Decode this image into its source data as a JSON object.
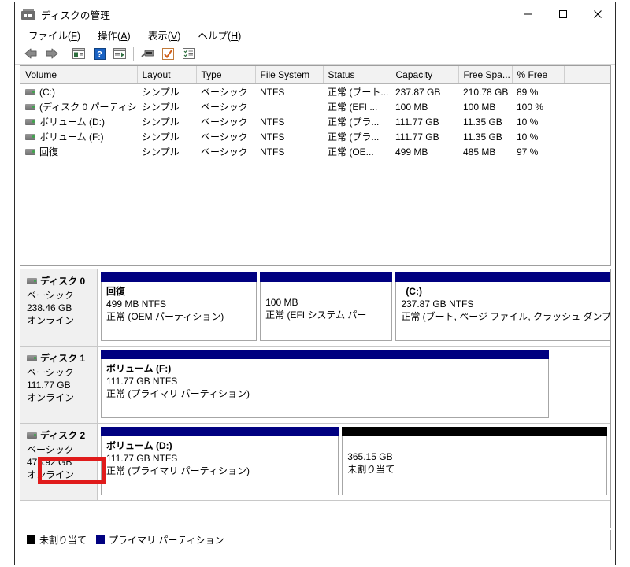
{
  "window": {
    "title": "ディスクの管理",
    "icon": "disk-management-icon",
    "controls": {
      "minimize": "–",
      "maximize": "□",
      "close": "✕"
    }
  },
  "menubar": {
    "items": [
      {
        "name": "file",
        "text": "ファイル",
        "accel": "F"
      },
      {
        "name": "action",
        "text": "操作",
        "accel": "A"
      },
      {
        "name": "view",
        "text": "表示",
        "accel": "V"
      },
      {
        "name": "help",
        "text": "ヘルプ",
        "accel": "H"
      }
    ]
  },
  "toolbar": {
    "buttons": [
      "back-arrow-icon",
      "forward-arrow-icon",
      "separator",
      "show-console-tree-icon",
      "help-icon",
      "show-action-pane-icon",
      "separator",
      "rescan-disks-icon",
      "properties-icon",
      "list-view-icon"
    ]
  },
  "volume_list": {
    "columns": [
      "Volume",
      "Layout",
      "Type",
      "File System",
      "Status",
      "Capacity",
      "Free Spa...",
      "% Free",
      ""
    ],
    "rows": [
      {
        "volume": "(C:)",
        "layout": "シンプル",
        "type": "ベーシック",
        "filesystem": "NTFS",
        "status": "正常 (ブート...",
        "capacity": "237.87 GB",
        "free_space": "210.78 GB",
        "percent_free": "89 %"
      },
      {
        "volume": "(ディスク 0 パーティシ...",
        "layout": "シンプル",
        "type": "ベーシック",
        "filesystem": "",
        "status": "正常 (EFI ...",
        "capacity": "100 MB",
        "free_space": "100 MB",
        "percent_free": "100 %"
      },
      {
        "volume": "ボリューム (D:)",
        "layout": "シンプル",
        "type": "ベーシック",
        "filesystem": "NTFS",
        "status": "正常 (プラ...",
        "capacity": "111.77 GB",
        "free_space": "11.35 GB",
        "percent_free": "10 %"
      },
      {
        "volume": "ボリューム (F:)",
        "layout": "シンプル",
        "type": "ベーシック",
        "filesystem": "NTFS",
        "status": "正常 (プラ...",
        "capacity": "111.77 GB",
        "free_space": "11.35 GB",
        "percent_free": "10 %"
      },
      {
        "volume": "回復",
        "layout": "シンプル",
        "type": "ベーシック",
        "filesystem": "NTFS",
        "status": "正常 (OE...",
        "capacity": "499 MB",
        "free_space": "485 MB",
        "percent_free": "97 %"
      }
    ]
  },
  "disks": [
    {
      "name": "ディスク 0",
      "type": "ベーシック",
      "capacity": "238.46 GB",
      "status": "オンライン",
      "partitions": [
        {
          "label": "回復",
          "size": "499 MB NTFS",
          "state": "正常 (OEM パーティション)",
          "kind": "primary",
          "width_pct": 26.5
        },
        {
          "label": "",
          "size": "100 MB",
          "state": "正常 (EFI システム パー",
          "kind": "primary",
          "width_pct": 22.5
        },
        {
          "label": "(C:)",
          "size": "237.87 GB NTFS",
          "state": "正常 (ブート, ページ ファイル, クラッシュ ダンプ, プライマリ パーティション",
          "kind": "primary",
          "width_pct": 51.0
        }
      ]
    },
    {
      "name": "ディスク 1",
      "type": "ベーシック",
      "capacity": "111.77 GB",
      "status": "オンライン",
      "partitions": [
        {
          "label": "ボリューム  (F:)",
          "size": "111.77 GB NTFS",
          "state": "正常 (プライマリ パーティション)",
          "kind": "primary",
          "width_pct": 88.5
        }
      ]
    },
    {
      "name": "ディスク 2",
      "type": "ベーシック",
      "capacity": "476.92 GB",
      "status": "オンライン",
      "partitions": [
        {
          "label": "ボリューム  (D:)",
          "size": "111.77 GB NTFS",
          "state": "正常 (プライマリ パーティション)",
          "kind": "primary",
          "width_pct": 47.0
        },
        {
          "label": "",
          "size": "365.15 GB",
          "state": "未割り当て",
          "kind": "unallocated",
          "width_pct": 53.0
        }
      ]
    }
  ],
  "annotation": {
    "name": "red-highlight-box",
    "color": "#e01b1b",
    "targets": [
      "disk2-capacity",
      "disk2-status"
    ]
  },
  "legend": {
    "items": [
      {
        "label": "未割り当て",
        "color": "#000000"
      },
      {
        "label": "プライマリ パーティション",
        "color": "#000080"
      }
    ]
  }
}
